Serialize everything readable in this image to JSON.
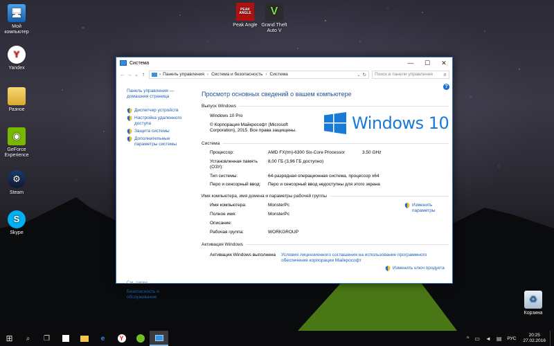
{
  "desktop": {
    "icons": [
      {
        "label": "Мой компьютер",
        "icon": "computer-icon"
      },
      {
        "label": "Yandex",
        "icon": "yandex-icon"
      },
      {
        "label": "Разное",
        "icon": "folder-icon"
      },
      {
        "label": "GeForce Experience",
        "icon": "geforce-icon"
      },
      {
        "label": "Steam",
        "icon": "steam-icon"
      },
      {
        "label": "Skype",
        "icon": "skype-icon"
      },
      {
        "label": "Peak Angle",
        "icon": "peak-angle-icon"
      },
      {
        "label": "Grand Theft Auto V",
        "icon": "gta-icon"
      },
      {
        "label": "Корзина",
        "icon": "recycle-bin-icon"
      }
    ],
    "peak_angle_badge": "PEAK ANGLE"
  },
  "window": {
    "title": "Система",
    "controls": {
      "minimize": "—",
      "maximize": "☐",
      "close": "✕"
    },
    "address": {
      "back": "←",
      "forward": "→",
      "dropdown": "⌄",
      "up": "↑",
      "crumbs": [
        "Панель управления",
        "Система и безопасность",
        "Система"
      ],
      "separator": "›",
      "refresh": "↻",
      "search_placeholder": "Поиск в панели управления",
      "search_icon": "⌕"
    },
    "left": {
      "home": "Панель управления — домашняя страница",
      "links": [
        "Диспетчер устройств",
        "Настройка удаленного доступа",
        "Защита системы",
        "Дополнительные параметры системы"
      ],
      "see_also": "См. также",
      "bottom_links": [
        "Безопасность и обслуживание"
      ]
    },
    "help": "?",
    "page_title": "Просмотр основных сведений о вашем компьютере",
    "edition": {
      "header": "Выпуск Windows",
      "name": "Windows 10 Pro",
      "copyright": "© Корпорация Майкрософт (Microsoft Corporation), 2015. Все права защищены.",
      "logo_text": "Windows 10"
    },
    "system": {
      "header": "Система",
      "rows": [
        {
          "k": "Процессор:",
          "v": "AMD FX(tm)-6300 Six-Core Processor",
          "v2": "3.50 GHz"
        },
        {
          "k": "Установленная память (ОЗУ):",
          "v": "8,00 ГБ (3,96 ГБ доступно)"
        },
        {
          "k": "Тип системы:",
          "v": "64-разрядная операционная система, процессор x64"
        },
        {
          "k": "Перо и сенсорный ввод:",
          "v": "Перо и сенсорный ввод недоступны для этого экрана"
        }
      ]
    },
    "computer": {
      "header": "Имя компьютера, имя домена и параметры рабочей группы",
      "change_link": "Изменить параметры",
      "rows": [
        {
          "k": "Имя компьютера:",
          "v": "MonsterPc"
        },
        {
          "k": "Полное имя:",
          "v": "MonsterPc"
        },
        {
          "k": "Описание:",
          "v": ""
        },
        {
          "k": "Рабочая группа:",
          "v": "WORKGROUP"
        }
      ]
    },
    "activation": {
      "header": "Активация Windows",
      "status": "Активация Windows выполнена",
      "license_link": "Условия лицензионного соглашения на использование программного обеспечения корпорации Майкрософт",
      "change_key": "Изменить ключ продукта"
    }
  },
  "taskbar": {
    "start": "⊞",
    "search": "⌕",
    "task_view": "❐",
    "apps": [
      "store-icon",
      "explorer-icon",
      "edge-icon",
      "yandex-icon",
      "utorrent-icon",
      "control-panel-icon"
    ],
    "tray": {
      "chevron": "^",
      "lang": "РУС",
      "time": "20:25",
      "date": "27.02.2016"
    }
  },
  "colors": {
    "accent": "#1a7bd6",
    "link": "#1a5fb4",
    "title_blue": "#1e4e9a"
  }
}
